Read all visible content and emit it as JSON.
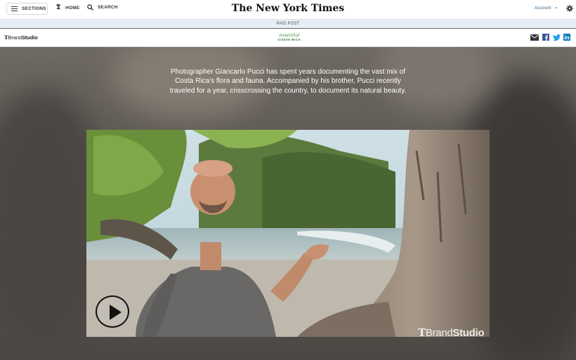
{
  "topnav": {
    "sections_label": "SECTIONS",
    "home_label": "HOME",
    "search_label": "SEARCH",
    "logo": "The New York Times",
    "account_label": "Account"
  },
  "paid_banner": {
    "label": "PAID POST"
  },
  "brand": {
    "tbrand_t": "T",
    "tbrand_a": "Brand",
    "tbrand_b": "Studio",
    "sponsor_script": "essential",
    "sponsor_name": "COSTA RICA"
  },
  "hero": {
    "intro": "Photographer Giancarlo Pucci has spent years documenting the vast mix of Costa Rica’s flora and fauna. Accompanied by his brother, Pucci recently traveled for a year, crisscrossing the country, to document its natural beauty.",
    "watermark_t": "T",
    "watermark_a": "Brand",
    "watermark_b": "Studio"
  },
  "colors": {
    "accent_link": "#326891",
    "banner_bg": "#e7eef7",
    "facebook": "#3b5998",
    "twitter": "#1da1f2",
    "linkedin": "#0077b5"
  },
  "icons": [
    "hamburger-icon",
    "t-logo-icon",
    "search-icon",
    "chevron-down-icon",
    "gear-icon",
    "email-icon",
    "facebook-icon",
    "twitter-icon",
    "linkedin-icon",
    "play-icon"
  ]
}
